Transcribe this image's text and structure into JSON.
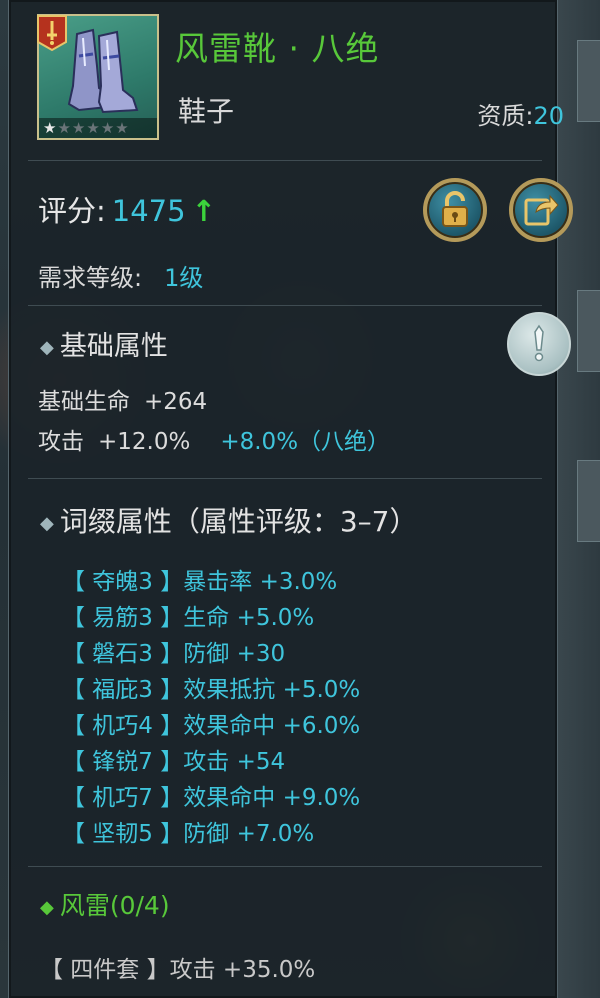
{
  "item": {
    "name": "风雷靴 · 八绝",
    "type": "鞋子",
    "quality_label": "资质:",
    "quality_value": "20",
    "stars_filled": 1,
    "stars_total": 6
  },
  "score": {
    "label": "评分:",
    "value": "1475",
    "trend": "up"
  },
  "requirement": {
    "label": "需求等级:",
    "value": "1级"
  },
  "base_attributes": {
    "title": "基础属性",
    "hp_label": "基础生命",
    "hp_value": "+264",
    "atk_label": "攻击",
    "atk_value": "+12.0%",
    "atk_bonus": "+8.0%（八绝）"
  },
  "affix_attributes": {
    "title": "词缀属性（属性评级：3–7）",
    "items": [
      {
        "text": "【 夺魄3 】暴击率 +3.0%"
      },
      {
        "text": "【 易筋3 】生命 +5.0%"
      },
      {
        "text": "【 磐石3 】防御 +30"
      },
      {
        "text": "【 福庇3 】效果抵抗 +5.0%"
      },
      {
        "text": "【 机巧4 】效果命中 +6.0%"
      },
      {
        "text": "【 锋锐7 】攻击 +54"
      },
      {
        "text": "【 机巧7 】效果命中 +9.0%"
      },
      {
        "text": "【 坚韧5 】防御 +7.0%"
      }
    ]
  },
  "set": {
    "title": "风雷(0/4)",
    "bonus": "【 四件套 】攻击 +35.0%"
  },
  "colors": {
    "name_green": "#58c83a",
    "value_cyan": "#3fc5dc",
    "frame_gold": "#b49a5a"
  },
  "icons": {
    "badge": "sword-badge-icon",
    "lock": "unlock-icon",
    "share": "share-arrow-icon",
    "info": "exclamation-icon",
    "trend": "up-arrow-icon"
  }
}
